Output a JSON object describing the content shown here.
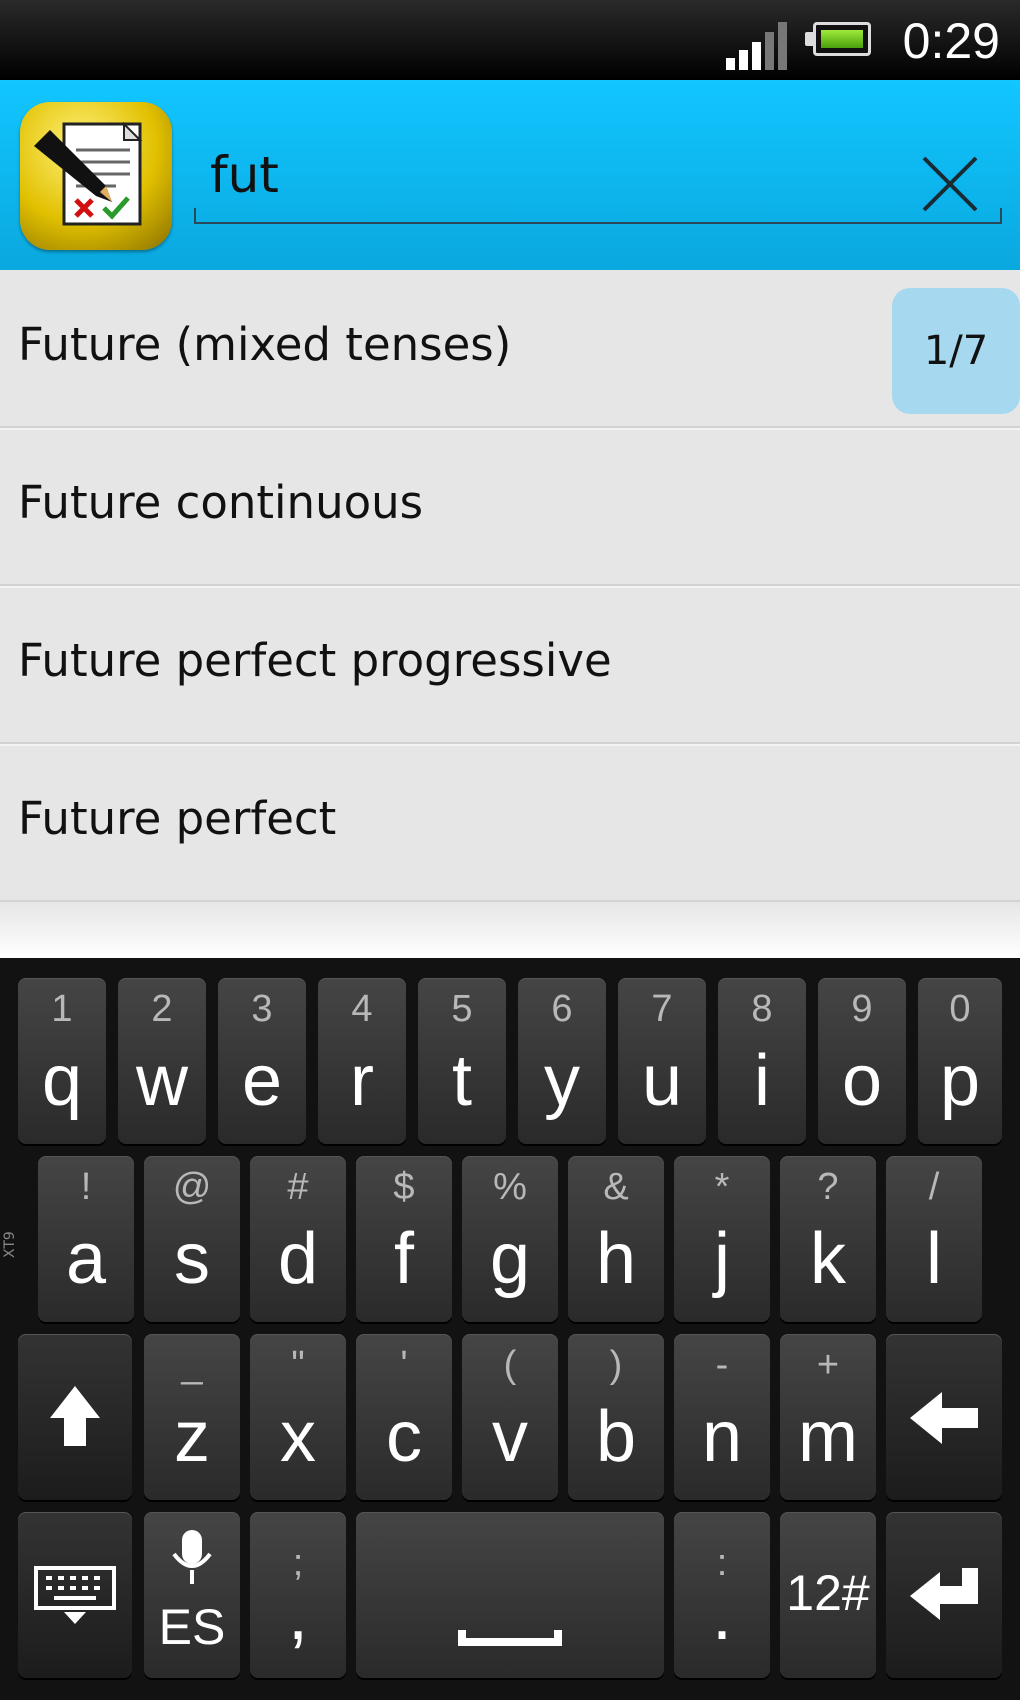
{
  "status_bar": {
    "time": "0:29",
    "signal_icon": "signal-icon",
    "battery_icon": "battery-icon"
  },
  "action_bar": {
    "app_icon": "app-logo-icon",
    "search_value": "fut",
    "clear_icon": "close-icon"
  },
  "results": [
    {
      "label": "Future (mixed tenses)",
      "badge": "1/7"
    },
    {
      "label": "Future continuous"
    },
    {
      "label": "Future perfect progressive"
    },
    {
      "label": "Future perfect"
    }
  ],
  "keyboard": {
    "row1": [
      {
        "sec": "1",
        "pri": "q"
      },
      {
        "sec": "2",
        "pri": "w"
      },
      {
        "sec": "3",
        "pri": "e"
      },
      {
        "sec": "4",
        "pri": "r"
      },
      {
        "sec": "5",
        "pri": "t"
      },
      {
        "sec": "6",
        "pri": "y"
      },
      {
        "sec": "7",
        "pri": "u"
      },
      {
        "sec": "8",
        "pri": "i"
      },
      {
        "sec": "9",
        "pri": "o"
      },
      {
        "sec": "0",
        "pri": "p"
      }
    ],
    "row2": [
      {
        "sec": "!",
        "pri": "a"
      },
      {
        "sec": "@",
        "pri": "s"
      },
      {
        "sec": "#",
        "pri": "d"
      },
      {
        "sec": "$",
        "pri": "f"
      },
      {
        "sec": "%",
        "pri": "g"
      },
      {
        "sec": "&",
        "pri": "h"
      },
      {
        "sec": "*",
        "pri": "j"
      },
      {
        "sec": "?",
        "pri": "k"
      },
      {
        "sec": "/",
        "pri": "l"
      }
    ],
    "row3": [
      {
        "sec": "_",
        "pri": "z"
      },
      {
        "sec": "\"",
        "pri": "x"
      },
      {
        "sec": "'",
        "pri": "c"
      },
      {
        "sec": "(",
        "pri": "v"
      },
      {
        "sec": ")",
        "pri": "b"
      },
      {
        "sec": "-",
        "pri": "n"
      },
      {
        "sec": "+",
        "pri": "m"
      }
    ],
    "xt9_label": "XT9",
    "lang_label": "ES",
    "semicolon_sec": ";",
    "comma_pri": ",",
    "colon_sec": ":",
    "period_pri": ".",
    "symbols_label": "12#"
  }
}
